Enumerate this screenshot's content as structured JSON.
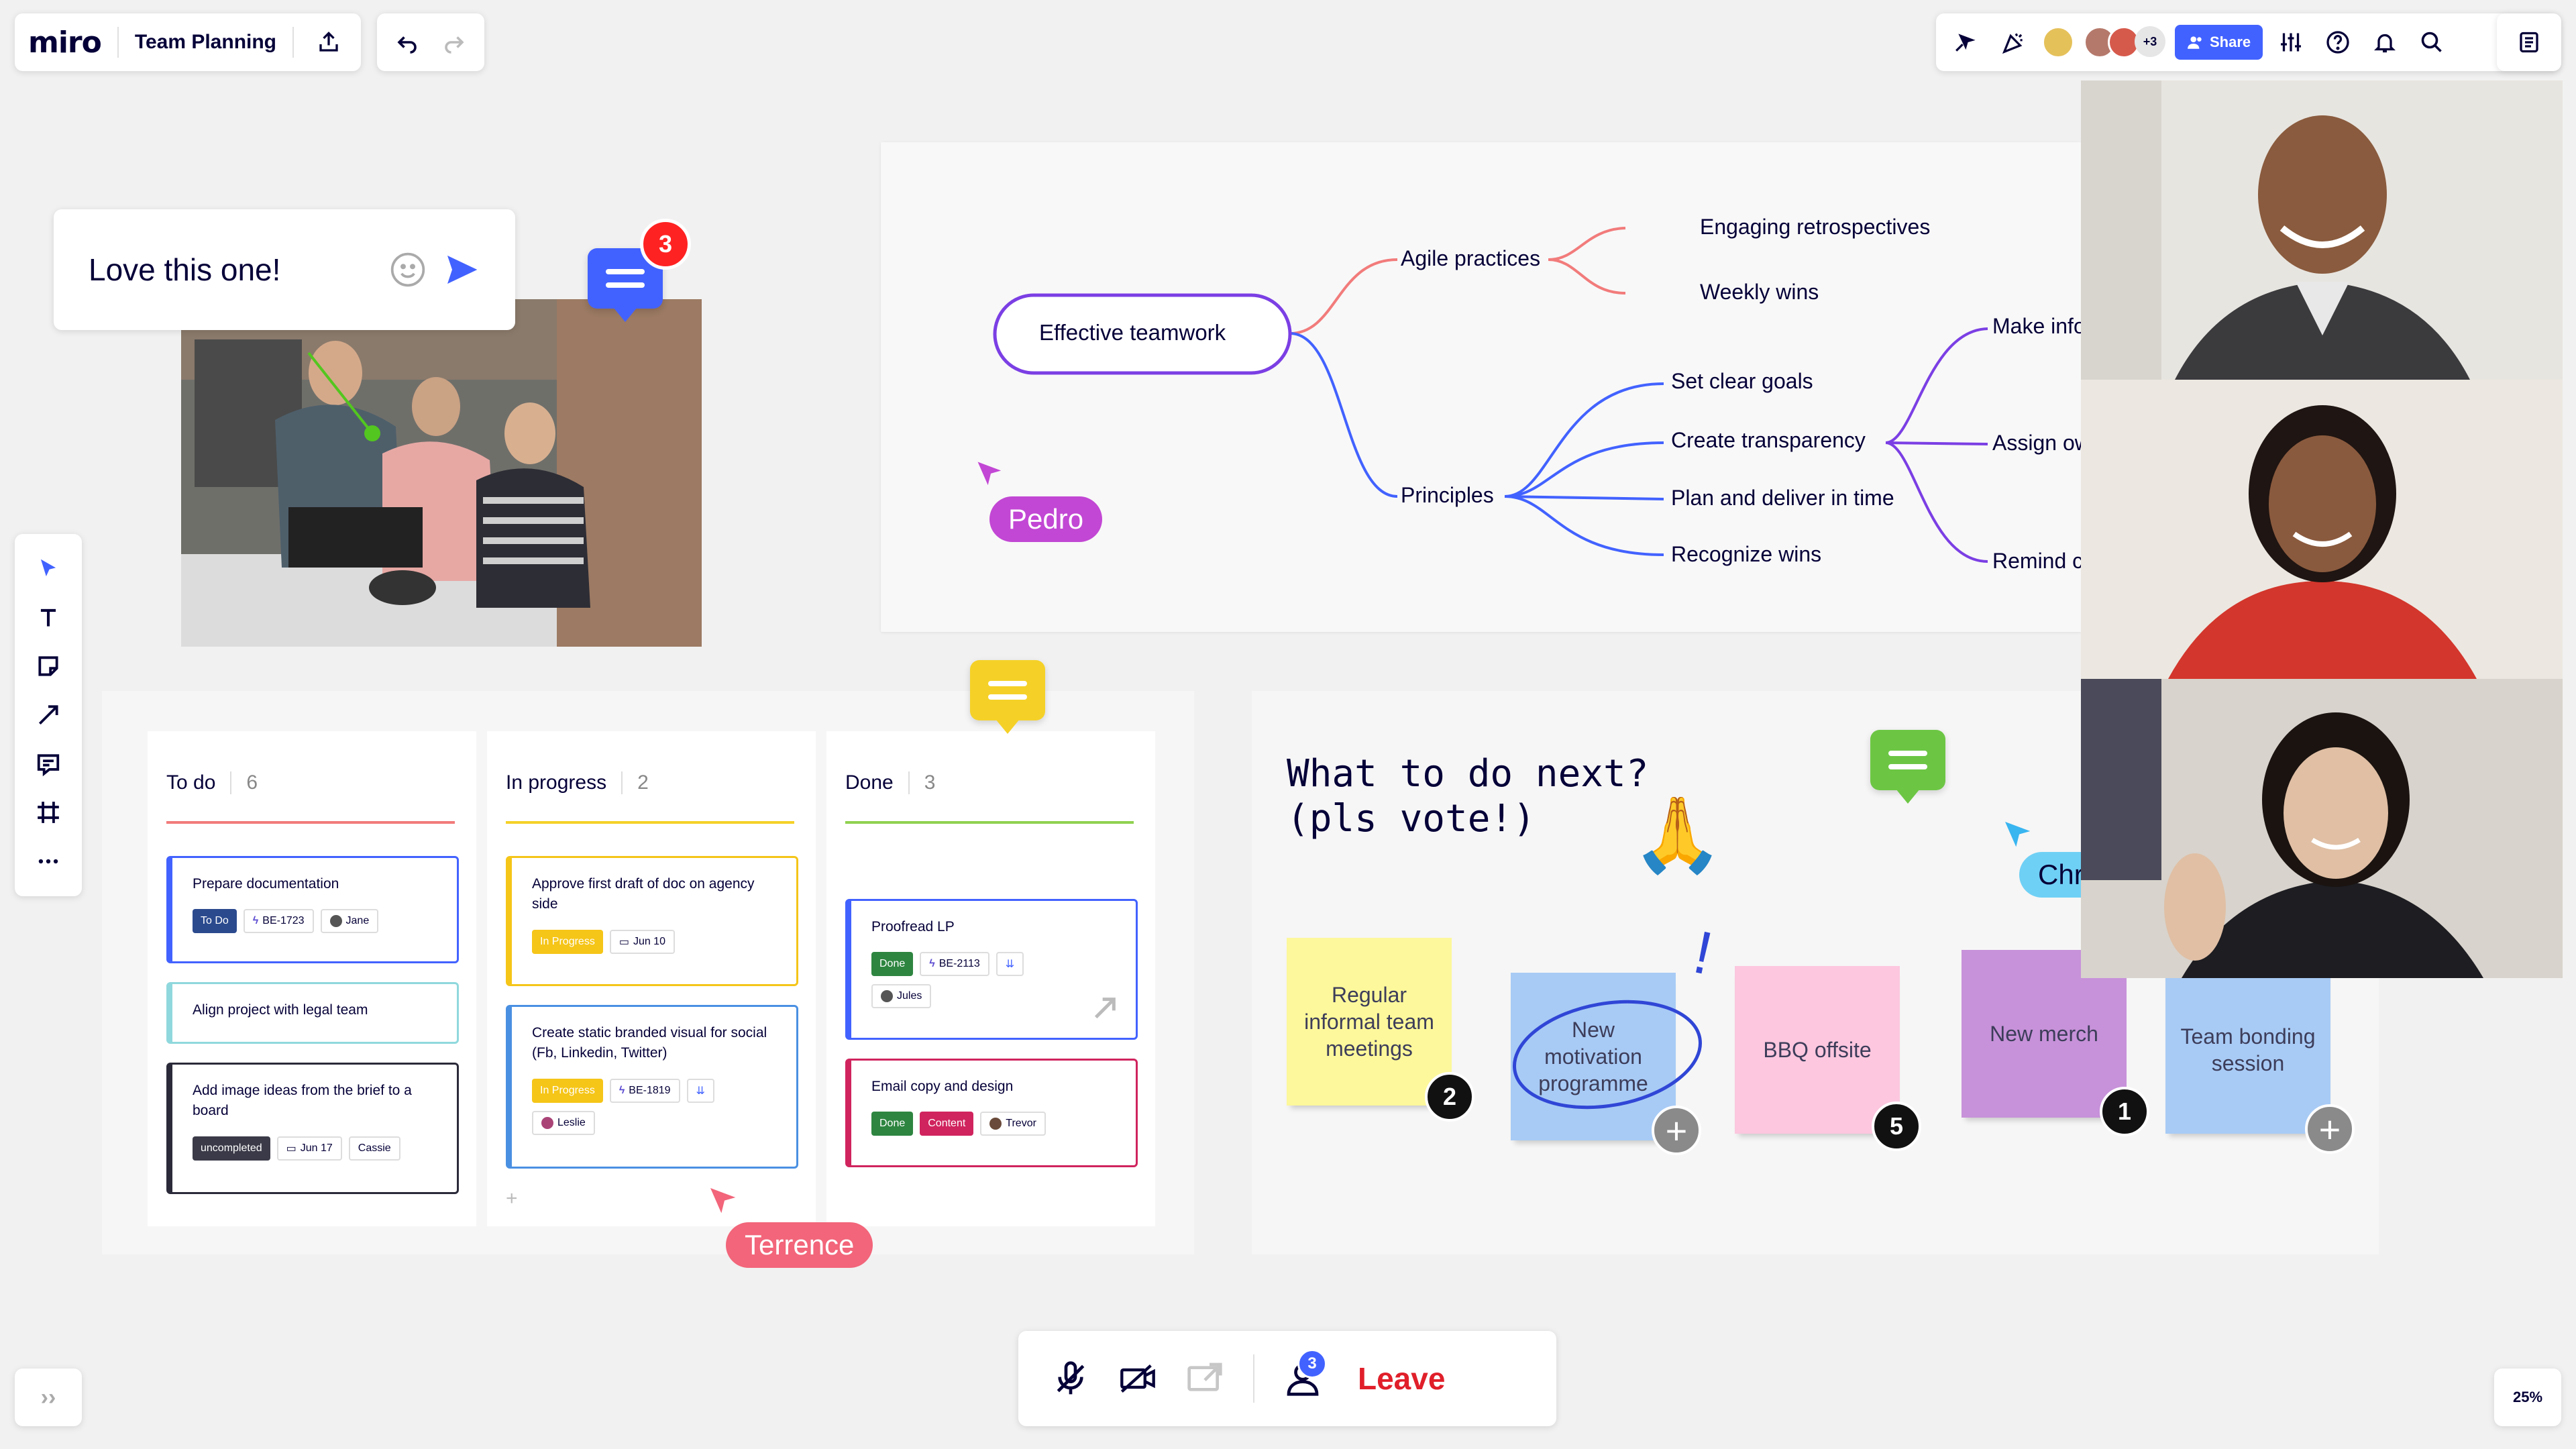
{
  "app": {
    "logo": "miro",
    "board_title": "Team Planning"
  },
  "topbar": {
    "more_collaborators": "+3",
    "share_label": "Share"
  },
  "comment": {
    "text": "Love this one!",
    "unread_count": "3"
  },
  "mindmap": {
    "root": "Effective teamwork",
    "branches": {
      "agile": "Agile practices",
      "agile_children": [
        "Engaging retrospectives",
        "Weekly wins"
      ],
      "principles": "Principles",
      "principles_children": [
        "Set clear goals",
        "Create transparency",
        "Plan and deliver in time",
        "Recognize wins"
      ],
      "transparency_children": [
        "Make info",
        "Assign ow",
        "Remind c"
      ]
    }
  },
  "cursors": {
    "pedro": "Pedro",
    "terrence": "Terrence",
    "chr": "Chr"
  },
  "kanban": {
    "columns": [
      {
        "title": "To do",
        "count": "6",
        "cards": [
          {
            "title": "Prepare documentation",
            "tags": [
              "To Do",
              "BE-1723",
              "Jane"
            ]
          },
          {
            "title": "Align project with legal team",
            "tags": []
          },
          {
            "title": "Add image ideas from the brief to a board",
            "tags": [
              "uncompleted",
              "Jun 17",
              "Cassie"
            ]
          }
        ]
      },
      {
        "title": "In progress",
        "count": "2",
        "cards": [
          {
            "title": "Approve first draft of doc on agency side",
            "tags": [
              "In Progress",
              "Jun 10"
            ]
          },
          {
            "title": "Create static branded visual for social (Fb, Linkedin, Twitter)",
            "tags": [
              "In Progress",
              "BE-1819",
              "Leslie"
            ]
          }
        ],
        "add": "+"
      },
      {
        "title": "Done",
        "count": "3",
        "cards": [
          {
            "title": "Proofread LP",
            "tags": [
              "Done",
              "BE-2113",
              "Jules"
            ]
          },
          {
            "title": "Email copy and design",
            "tags": [
              "Done",
              "Content",
              "Trevor"
            ]
          }
        ]
      }
    ]
  },
  "vote": {
    "title": "What to do next?\n(pls vote!)",
    "emoji": "🙏",
    "exclamation": "!",
    "stickies": [
      {
        "text": "Regular informal team meetings",
        "votes": "2",
        "color": "#fdf89b"
      },
      {
        "text": "New motivation programme",
        "votes": "",
        "color": "#a8cbf5"
      },
      {
        "text": "BBQ offsite",
        "votes": "5",
        "color": "#fcc7df"
      },
      {
        "text": "New merch",
        "votes": "1",
        "color": "#c792d9"
      },
      {
        "text": "Team bonding session",
        "votes": "",
        "color": "#a8cbf5"
      }
    ],
    "add": "+"
  },
  "callbar": {
    "participants": "3",
    "leave": "Leave"
  },
  "footer": {
    "expand": "››",
    "zoom": "25%"
  },
  "colors": {
    "accent": "#4262ff",
    "mint_yellow": "#f5d128",
    "red_badge": "#ff2222"
  }
}
